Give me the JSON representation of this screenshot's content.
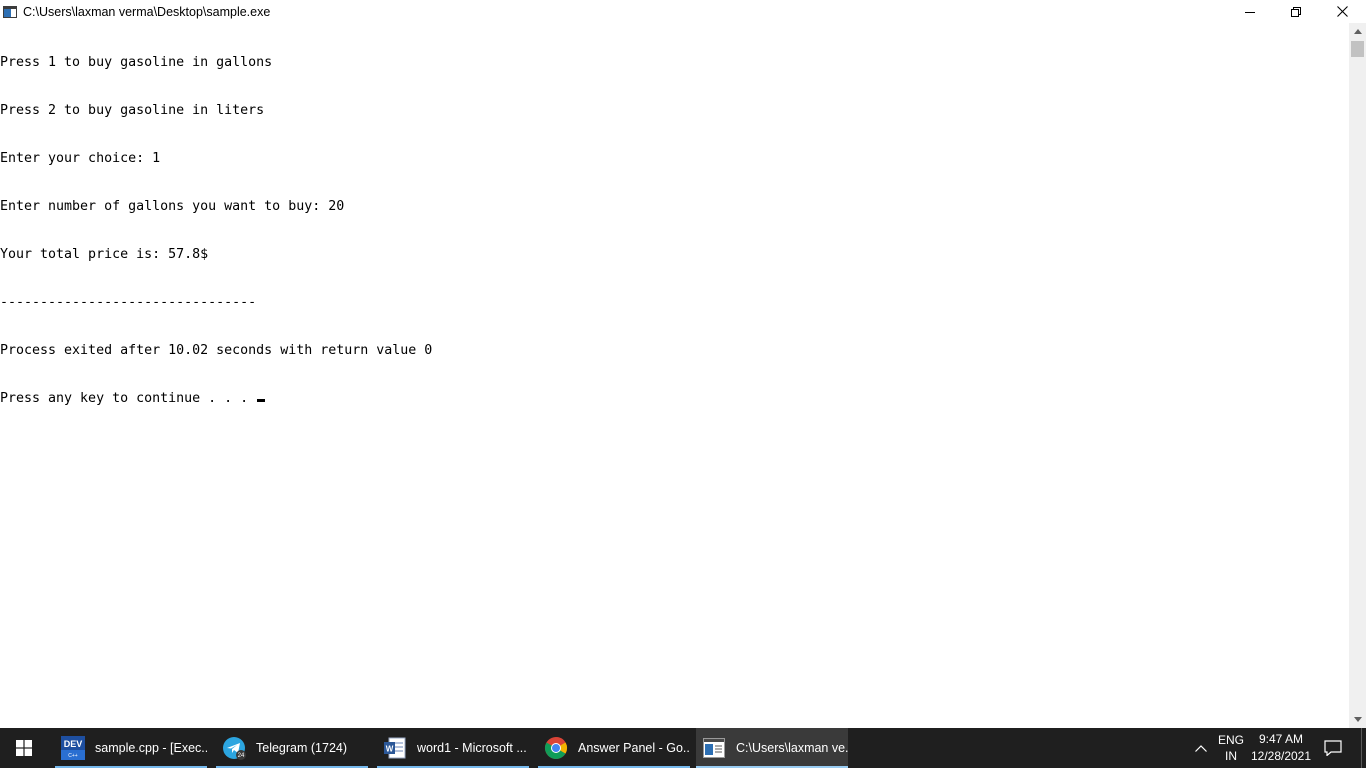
{
  "window": {
    "title": "C:\\Users\\laxman verma\\Desktop\\sample.exe",
    "icon": "console-window-icon",
    "controls": {
      "minimize": "minimize-icon",
      "maximize": "restore-icon",
      "close": "close-icon"
    }
  },
  "console": {
    "lines": [
      "Press 1 to buy gasoline in gallons",
      "Press 2 to buy gasoline in liters",
      "Enter your choice: 1",
      "Enter number of gallons you want to buy: 20",
      "Your total price is: 57.8$",
      "--------------------------------",
      "Process exited after 10.02 seconds with return value 0",
      "Press any key to continue . . . "
    ],
    "text_color": "#000000",
    "background_color": "#ffffff"
  },
  "taskbar": {
    "background_color": "#1f1f1f",
    "start_icon": "windows-logo-icon",
    "items": [
      {
        "label": "sample.cpp - [Exec...",
        "icon": "dev-cpp-icon",
        "icon_text": "DEV",
        "active": false
      },
      {
        "label": "Telegram (1724)",
        "icon": "telegram-icon",
        "badge": "24",
        "active": false
      },
      {
        "label": "word1 - Microsoft ...",
        "icon": "word-icon",
        "icon_text": "W",
        "active": false
      },
      {
        "label": "Answer Panel - Go...",
        "icon": "chrome-icon",
        "active": false
      },
      {
        "label": "C:\\Users\\laxman ve...",
        "icon": "console-window-icon",
        "active": true
      }
    ],
    "tray": {
      "chevron_icon": "chevron-up-icon",
      "language_line1": "ENG",
      "language_line2": "IN",
      "time": "9:47 AM",
      "date": "12/28/2021",
      "notification_icon": "notification-icon"
    }
  }
}
